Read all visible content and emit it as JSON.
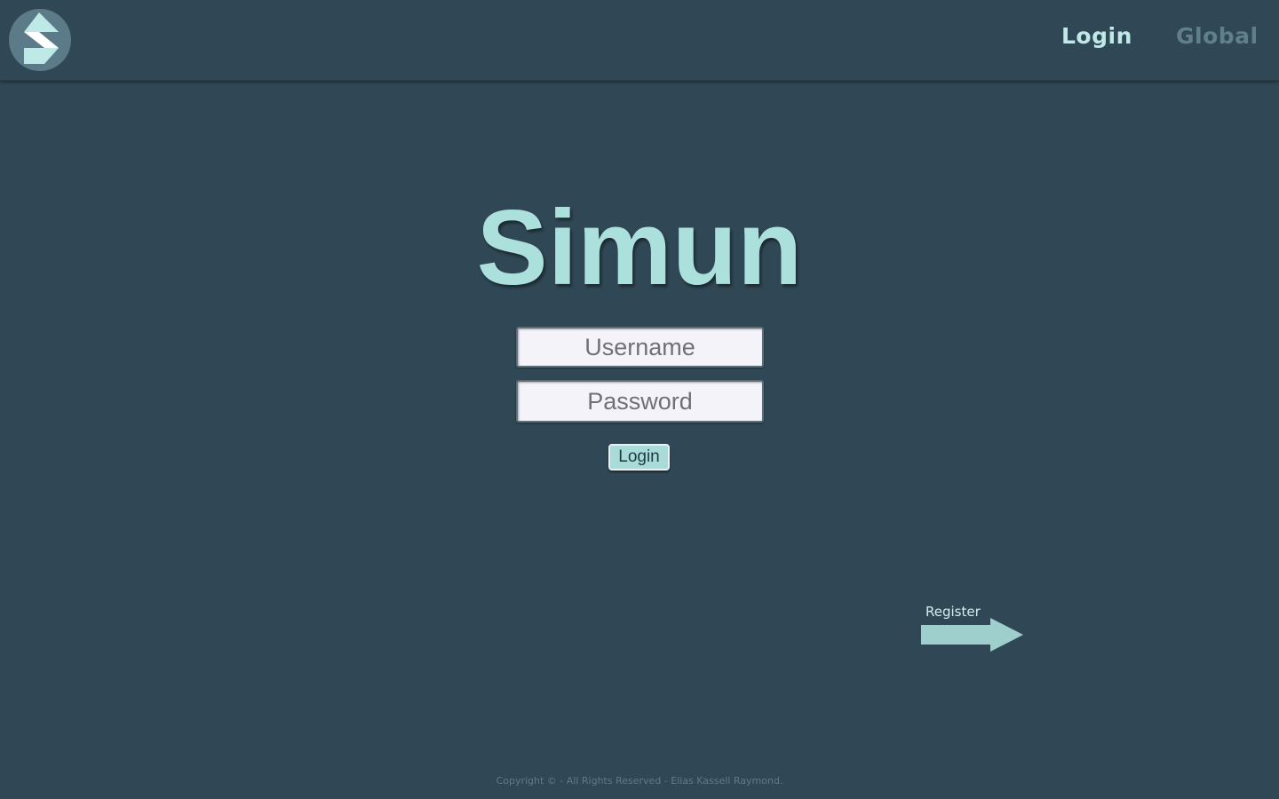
{
  "header": {
    "logo_icon": "simun-logo-icon",
    "nav": {
      "login_label": "Login",
      "global_label": "Global"
    }
  },
  "main": {
    "title": "Simun",
    "username": {
      "placeholder": "Username",
      "value": ""
    },
    "password": {
      "placeholder": "Password",
      "value": ""
    },
    "login_button_label": "Login"
  },
  "register": {
    "label": "Register",
    "icon": "arrow-right-icon"
  },
  "footer": {
    "copyright": "Copyright © - All Rights Reserved - Elias Kassell Raymond."
  },
  "colors": {
    "background": "#304855",
    "accent": "#ace0dc",
    "nav_active": "#bfe9e6",
    "nav_inactive": "#5f7f8a"
  }
}
